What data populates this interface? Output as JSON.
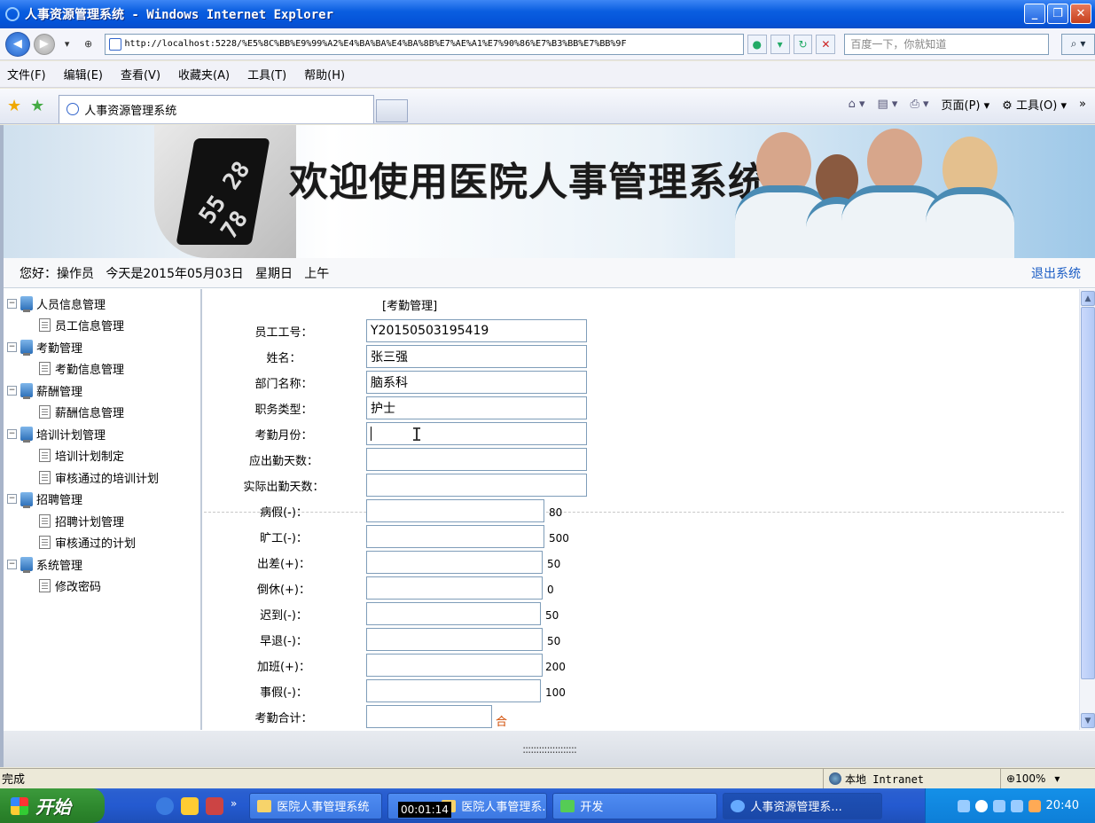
{
  "window": {
    "title": "人事资源管理系统 - Windows Internet Explorer",
    "buttons": [
      "_",
      "❐",
      "✕"
    ]
  },
  "address": {
    "url": "http://localhost:5228/%E5%8C%BB%E9%99%A2%E4%BA%BA%E4%BA%8B%E7%AE%A1%E7%90%86%E7%B3%BB%E7%BB%9F",
    "search_placeholder": "百度一下，你就知道"
  },
  "menu": [
    "文件(F)",
    "编辑(E)",
    "查看(V)",
    "收藏夹(A)",
    "工具(T)",
    "帮助(H)"
  ],
  "tab": {
    "label": "人事资源管理系统"
  },
  "commands": {
    "page": "页面(P)",
    "tools": "工具(O)"
  },
  "banner": {
    "title": "欢迎使用医院人事管理系统",
    "device_digits": "55 28 78"
  },
  "greeting": {
    "text": "您好：操作员   今天是2015年05月03日   星期日   上午",
    "logout": "退出系统"
  },
  "sidebar": [
    {
      "label": "人员信息管理",
      "children": [
        "员工信息管理"
      ]
    },
    {
      "label": "考勤管理",
      "children": [
        "考勤信息管理"
      ]
    },
    {
      "label": "薪酬管理",
      "children": [
        "薪酬信息管理"
      ]
    },
    {
      "label": "培训计划管理",
      "children": [
        "培训计划制定",
        "审核通过的培训计划"
      ]
    },
    {
      "label": "招聘管理",
      "children": [
        "招聘计划管理",
        "审核通过的计划"
      ]
    },
    {
      "label": "系统管理",
      "children": [
        "修改密码"
      ]
    }
  ],
  "form": {
    "section_title": "[考勤管理]",
    "fields": [
      {
        "label": "员工工号：",
        "value": "Y20150503195419"
      },
      {
        "label": "姓名：",
        "value": "张三强"
      },
      {
        "label": "部门名称：",
        "value": "脑系科"
      },
      {
        "label": "职务类型：",
        "value": "护士"
      },
      {
        "label": "考勤月份：",
        "value": ""
      },
      {
        "label": "应出勤天数：",
        "value": ""
      },
      {
        "label": "实际出勤天数：",
        "value": ""
      }
    ],
    "items": [
      {
        "label": "病假(-)：",
        "value": "",
        "rate": "80"
      },
      {
        "label": "旷工(-)：",
        "value": "",
        "rate": "500"
      },
      {
        "label": "出差(+)：",
        "value": "",
        "rate": "50"
      },
      {
        "label": "倒休(+)：",
        "value": "",
        "rate": "0"
      },
      {
        "label": "迟到(-)：",
        "value": "",
        "rate": "50"
      },
      {
        "label": "早退(-)：",
        "value": "",
        "rate": "50"
      },
      {
        "label": "加班(+)：",
        "value": "",
        "rate": "200"
      },
      {
        "label": "事假(-)：",
        "value": "",
        "rate": "100"
      }
    ],
    "total": {
      "label": "考勤合计：",
      "value": "",
      "link": "合计"
    }
  },
  "bottom_strip": "::::::::::::::::::::",
  "status": {
    "text": "完成",
    "zone": "本地 Intranet",
    "zoom": "100%"
  },
  "taskbar": {
    "start": "开始",
    "tasks": [
      "医院人事管理系统",
      "医院人事管理系...",
      "开发",
      "人事资源管理系..."
    ],
    "timer": "00:01:14",
    "clock": "20:40"
  }
}
